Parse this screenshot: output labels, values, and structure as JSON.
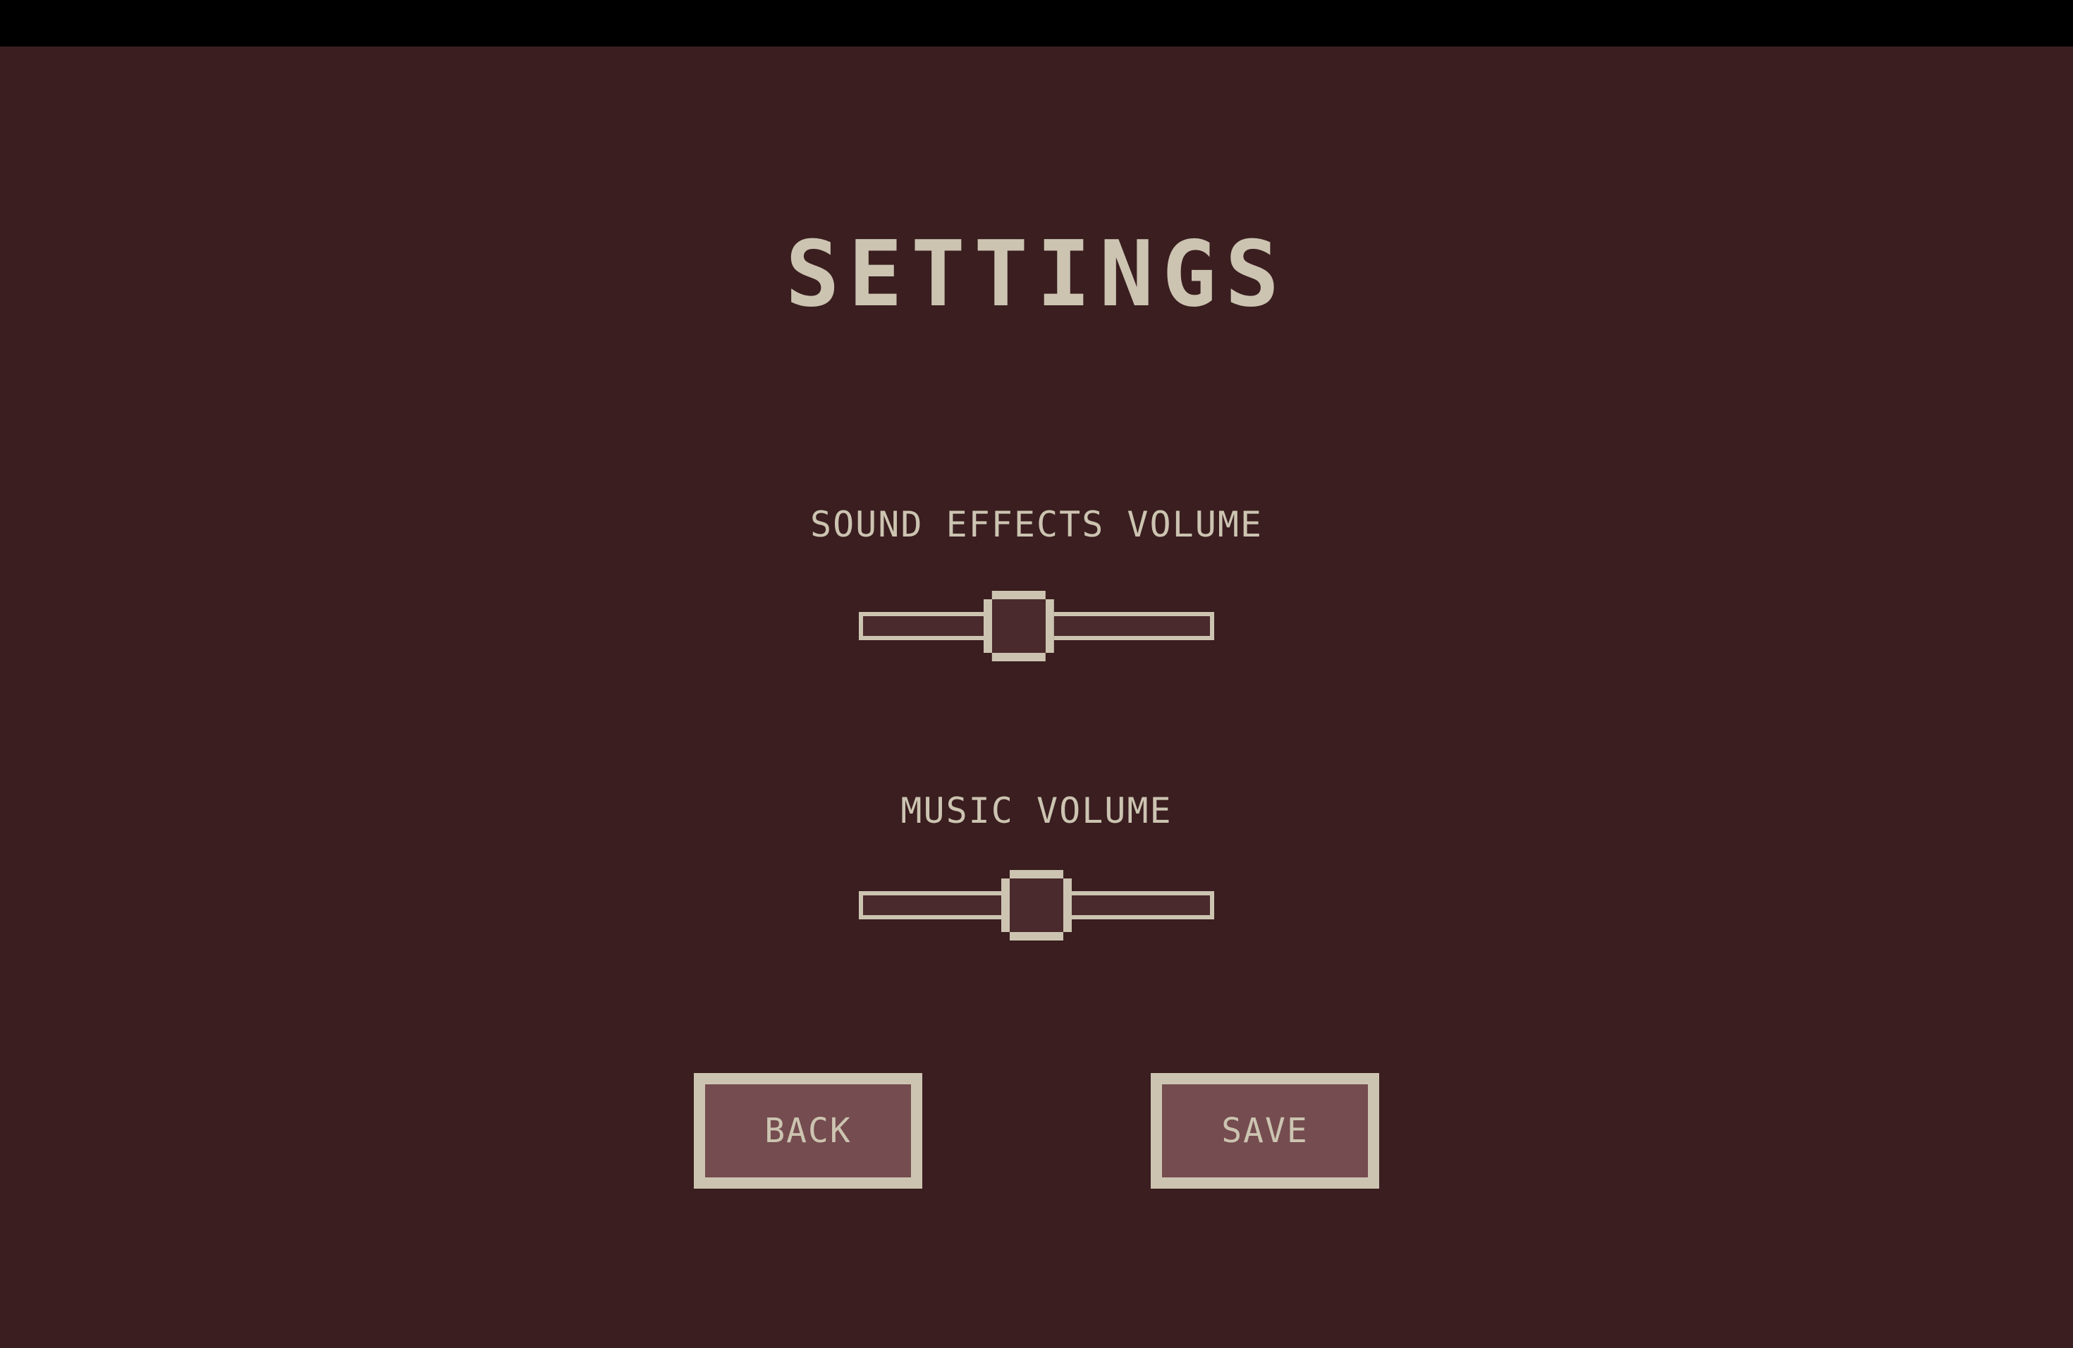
{
  "screen": {
    "title": "SETTINGS"
  },
  "settings": {
    "sfx": {
      "label": "SOUND EFFECTS VOLUME",
      "value": 0.45
    },
    "music": {
      "label": "MUSIC VOLUME",
      "value": 0.5
    }
  },
  "buttons": {
    "back_label": "BACK",
    "save_label": "SAVE"
  },
  "colors": {
    "background": "#3a1e20",
    "text": "#ccc4b1",
    "button_fill": "#754c4f",
    "top_bar": "#000000"
  }
}
